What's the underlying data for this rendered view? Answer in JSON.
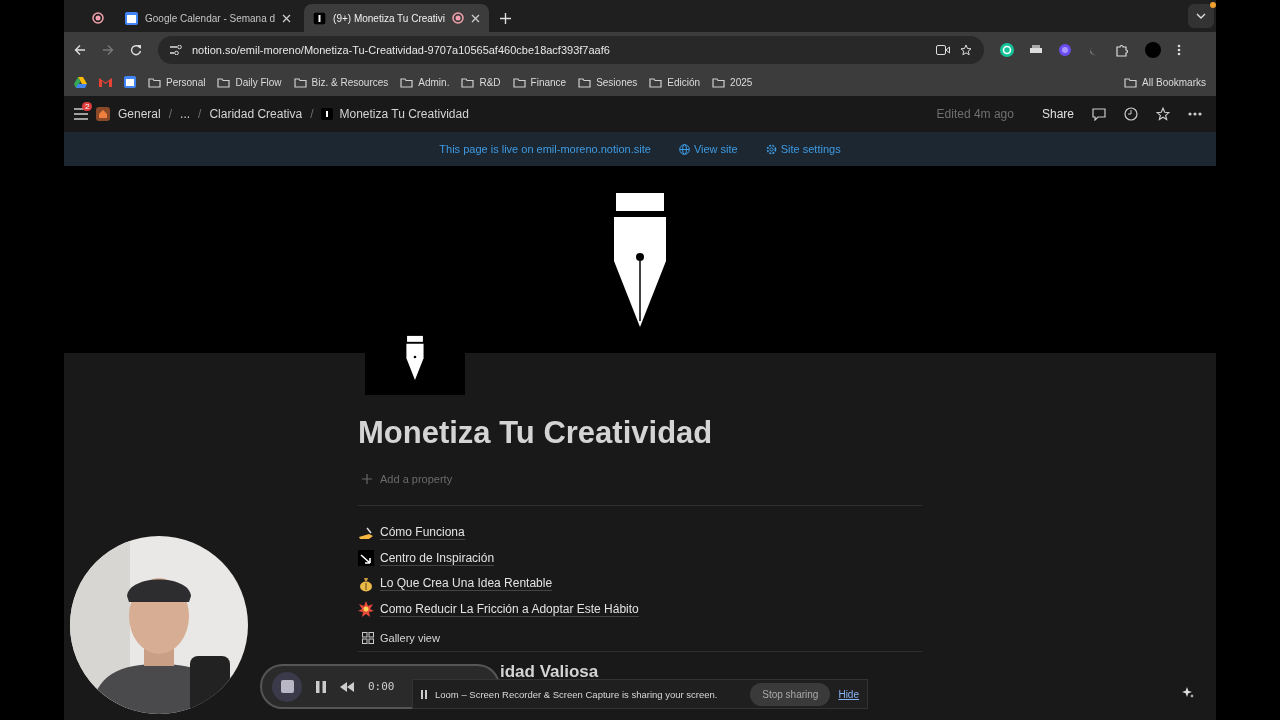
{
  "browser": {
    "tabs": [
      {
        "title": "Google Calendar - Semana d",
        "selected": false
      },
      {
        "title": "(9+) Monetiza Tu Creativi",
        "selected": true
      }
    ],
    "url": "notion.so/emil-moreno/Monetiza-Tu-Creatividad-9707a10565af460cbe18acf393f7aaf6",
    "bookmarks": [
      "Personal",
      "Daily Flow",
      "Biz. & Resources",
      "Admin.",
      "R&D",
      "Finance",
      "Sesiones",
      "Edición",
      "2025"
    ],
    "all_bookmarks": "All Bookmarks"
  },
  "topbar": {
    "badge": "2",
    "separator": "/",
    "breadcrumbs": [
      "General",
      "...",
      "Claridad Creativa",
      "Monetiza Tu Creatividad"
    ],
    "edited": "Edited 4m ago",
    "share": "Share"
  },
  "banner": {
    "text": "This page is live on emil-moreno.notion.site",
    "view_site": "View site",
    "site_settings": "Site settings"
  },
  "page": {
    "title": "Monetiza Tu Creatividad",
    "add_property": "Add a property",
    "links": [
      {
        "kind": "writing",
        "title": "Cómo Funciona"
      },
      {
        "kind": "arrow",
        "title": "Centro de Inspiración"
      },
      {
        "kind": "money",
        "title": "Lo Que Crea Una Idea Rentable"
      },
      {
        "kind": "burst",
        "title": "Como Reducir La Fricción a Adoptar Este Hábito"
      }
    ],
    "view": "Gallery view",
    "heading": "idad Valiosa"
  },
  "loom": {
    "time": "0:00",
    "message": "Loom – Screen Recorder & Screen Capture is sharing your screen.",
    "stop": "Stop sharing",
    "hide": "Hide"
  }
}
